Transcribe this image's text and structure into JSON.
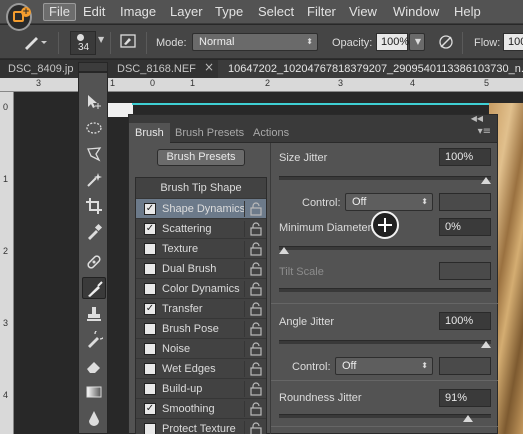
{
  "menubar": {
    "items": [
      "File",
      "Edit",
      "Image",
      "Layer",
      "Type",
      "Select",
      "Filter",
      "View",
      "Window",
      "Help"
    ]
  },
  "optionsbar": {
    "brush_size": "34",
    "mode_label": "Mode:",
    "mode_value": "Normal",
    "opacity_label": "Opacity:",
    "opacity_value": "100%",
    "flow_label": "Flow:",
    "flow_value": "100"
  },
  "tabs": [
    {
      "label": "DSC_8409.jp",
      "active": false
    },
    {
      "label": "DSC_8168.NEF",
      "active": false
    },
    {
      "label": "10647202_10204767818379207_2909540113386103730_n.jp",
      "active": true
    }
  ],
  "ruler": {
    "h_numbers": [
      "3",
      "1",
      "0",
      "1",
      "2",
      "3",
      "4",
      "5"
    ],
    "v_numbers": [
      "0",
      "1",
      "2",
      "3",
      "4"
    ]
  },
  "panel": {
    "tabs": [
      "Brush",
      "Brush Presets",
      "Actions"
    ],
    "presets_button": "Brush Presets",
    "list_header": "Brush Tip Shape",
    "list_items": [
      {
        "label": "Shape Dynamics",
        "checked": true,
        "selected": true
      },
      {
        "label": "Scattering",
        "checked": true,
        "selected": false
      },
      {
        "label": "Texture",
        "checked": false,
        "selected": false
      },
      {
        "label": "Dual Brush",
        "checked": false,
        "selected": false
      },
      {
        "label": "Color Dynamics",
        "checked": false,
        "selected": false
      },
      {
        "label": "Transfer",
        "checked": true,
        "selected": false
      },
      {
        "label": "Brush Pose",
        "checked": false,
        "selected": false
      },
      {
        "label": "Noise",
        "checked": false,
        "selected": false
      },
      {
        "label": "Wet Edges",
        "checked": false,
        "selected": false
      },
      {
        "label": "Build-up",
        "checked": false,
        "selected": false
      },
      {
        "label": "Smoothing",
        "checked": true,
        "selected": false
      },
      {
        "label": "Protect Texture",
        "checked": false,
        "selected": false
      }
    ],
    "right": {
      "size_jitter_label": "Size Jitter",
      "size_jitter_value": "100%",
      "size_jitter_level": 1.0,
      "control_label": "Control:",
      "control_value": "Off",
      "min_diameter_label": "Minimum Diameter",
      "min_diameter_value": "0%",
      "min_diameter_level": 0.0,
      "tilt_scale_label": "Tilt Scale",
      "angle_jitter_label": "Angle Jitter",
      "angle_jitter_value": "100%",
      "angle_jitter_level": 1.0,
      "control2_label": "Control:",
      "control2_value": "Off",
      "roundness_jitter_label": "Roundness Jitter",
      "roundness_jitter_value": "91%",
      "roundness_jitter_level": 0.91
    }
  },
  "colors": {
    "accent_cyan": "#3fd0d4",
    "ps_orange": "#f39c2e",
    "selected_row": "#6c7a8a"
  }
}
